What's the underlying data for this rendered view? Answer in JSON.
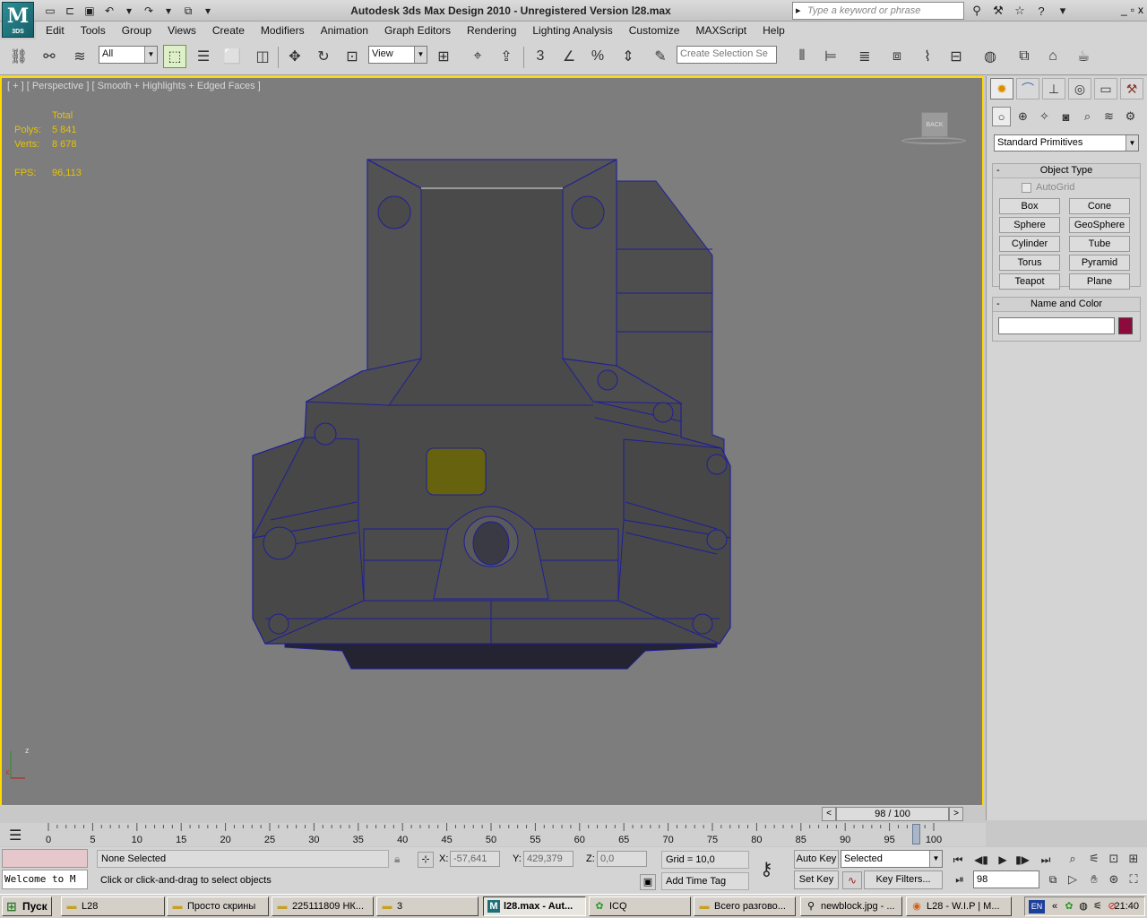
{
  "title_bar": {
    "app_logo_text": "M",
    "app_logo_sub": "3DS",
    "window_title": "Autodesk 3ds Max Design 2010   -  Unregistered Version     l28.max",
    "search_placeholder": "Type a keyword or phrase",
    "win_controls": [
      "_",
      "▫",
      "x"
    ]
  },
  "menu": [
    "Edit",
    "Tools",
    "Group",
    "Views",
    "Create",
    "Modifiers",
    "Animation",
    "Graph Editors",
    "Rendering",
    "Lighting Analysis",
    "Customize",
    "MAXScript",
    "Help"
  ],
  "toolbar": {
    "selection_filter": "All",
    "reference_coord": "View",
    "named_selection_placeholder": "Create Selection Se",
    "snap_toggle_label": "3",
    "percent_snap_label": "%"
  },
  "viewport": {
    "label": "[ + ] [ Perspective ] [ Smooth + Highlights + Edged Faces ]",
    "stats": {
      "total_label": "Total",
      "polys_label": "Polys:",
      "polys": "5 841",
      "verts_label": "Verts:",
      "verts": "8 678",
      "fps_label": "FPS:",
      "fps": "96,113"
    },
    "viewcube_label": "BACK",
    "axis_z": "z",
    "axis_x": "x"
  },
  "command_panel": {
    "category": "Standard Primitives",
    "object_type_title": "Object Type",
    "autogrid_label": "AutoGrid",
    "primitives": [
      "Box",
      "Cone",
      "Sphere",
      "GeoSphere",
      "Cylinder",
      "Tube",
      "Torus",
      "Pyramid",
      "Teapot",
      "Plane"
    ],
    "name_color_title": "Name and Color",
    "object_color": "#8c0a3c"
  },
  "timeline": {
    "frame_label": "98 / 100",
    "current_frame": 98,
    "total_frames": 100,
    "tick_labels": [
      "0",
      "5",
      "10",
      "15",
      "20",
      "25",
      "30",
      "35",
      "40",
      "45",
      "50",
      "55",
      "60",
      "65",
      "70",
      "75",
      "80",
      "85",
      "90",
      "95",
      "100"
    ]
  },
  "status": {
    "listener_text": "Welcome to M",
    "selection": "None Selected",
    "prompt": "Click or click-and-drag to select objects",
    "x_label": "X:",
    "x_value": "-57,641",
    "y_label": "Y:",
    "y_value": "429,379",
    "z_label": "Z:",
    "z_value": "0,0",
    "grid": "Grid = 10,0",
    "add_time_tag": "Add Time Tag",
    "auto_key": "Auto Key",
    "set_key": "Set Key",
    "key_mode": "Selected",
    "key_filters": "Key Filters...",
    "frame_field": "98"
  },
  "taskbar": {
    "start": "Пуск",
    "tasks": [
      {
        "label": "L28",
        "icon": "folder-icon"
      },
      {
        "label": "Просто скрины",
        "icon": "folder-icon"
      },
      {
        "label": "225111809 НК...",
        "icon": "folder-icon"
      },
      {
        "label": "3",
        "icon": "folder-icon"
      },
      {
        "label": "l28.max - Aut...",
        "icon": "max-icon",
        "active": true
      },
      {
        "label": "ICQ",
        "icon": "icq-icon"
      },
      {
        "label": "Всего разгово...",
        "icon": "chat-icon"
      },
      {
        "label": "newblock.jpg - ...",
        "icon": "image-icon"
      },
      {
        "label": "L28 - W.I.P | M...",
        "icon": "browser-icon"
      }
    ],
    "lang": "EN",
    "clock": "21:40"
  }
}
